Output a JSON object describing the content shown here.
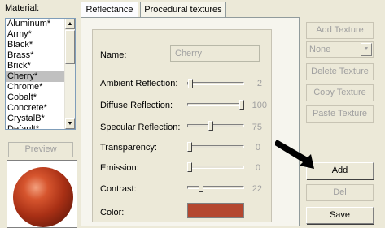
{
  "material": {
    "label": "Material:",
    "items": [
      "Aluminum*",
      "Army*",
      "Black*",
      "Brass*",
      "Brick*",
      "Cherry*",
      "Chrome*",
      "Cobalt*",
      "Concrete*",
      "CrystalB*",
      "Default*"
    ],
    "selected_index": 5
  },
  "preview": {
    "button_label": "Preview",
    "sphere_color": "#b33a1c"
  },
  "tabs": [
    {
      "label": "Reflectance",
      "active": true
    },
    {
      "label": "Procedural textures",
      "active": false
    }
  ],
  "props": {
    "name_label": "Name:",
    "name_value": "Cherry",
    "sliders": [
      {
        "label": "Ambient Reflection:",
        "value": "2",
        "fraction": 0.02
      },
      {
        "label": "Diffuse Reflection:",
        "value": "100",
        "fraction": 1.0
      },
      {
        "label": "Specular Reflection:",
        "value": "75",
        "fraction": 0.4
      },
      {
        "label": "Transparency:",
        "value": "0",
        "fraction": 0.0
      },
      {
        "label": "Emission:",
        "value": "0",
        "fraction": 0.0
      },
      {
        "label": "Contrast:",
        "value": "22",
        "fraction": 0.22
      }
    ],
    "color_label": "Color:",
    "color_value": "#b4472f"
  },
  "buttons": {
    "add_texture": "Add Texture",
    "none_select": "None",
    "delete_texture": "Delete Texture",
    "copy_texture": "Copy Texture",
    "paste_texture": "Paste Texture",
    "add": "Add",
    "del": "Del",
    "save": "Save"
  }
}
